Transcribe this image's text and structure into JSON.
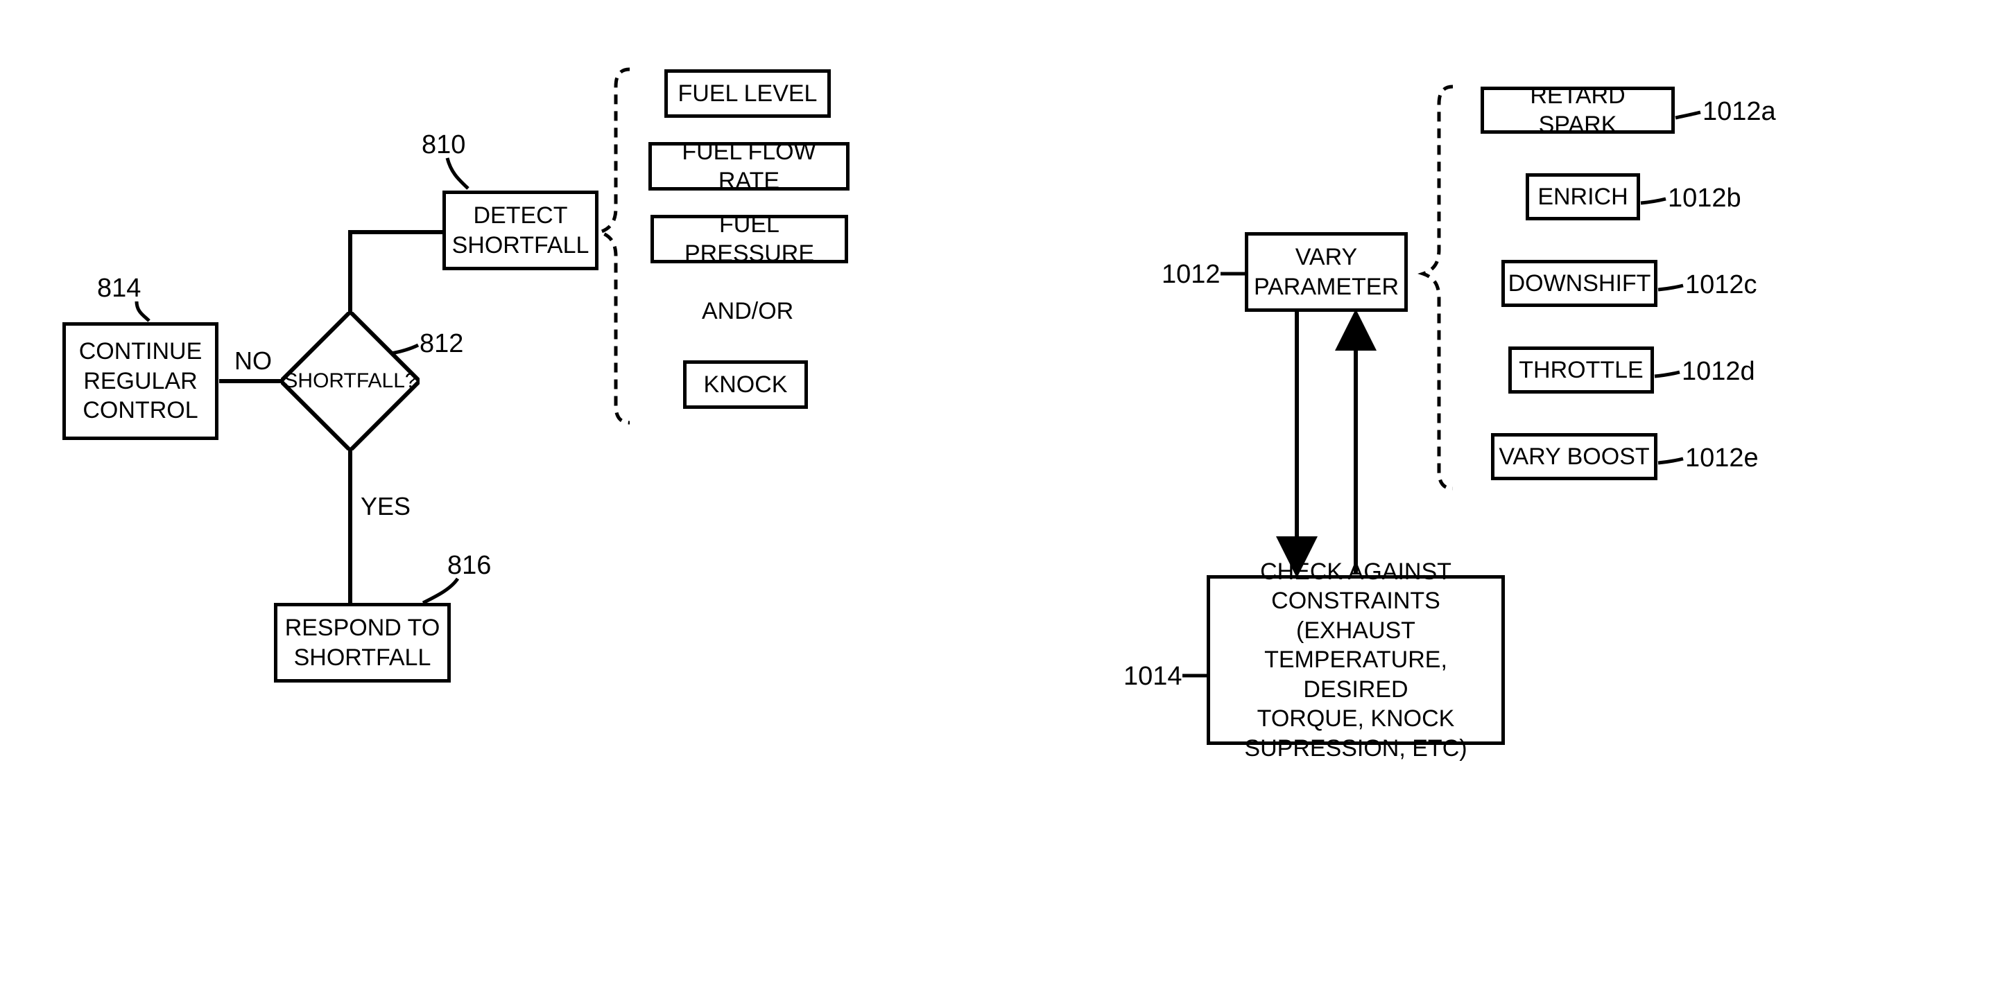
{
  "left": {
    "continue": {
      "text": "CONTINUE\nREGULAR\nCONTROL",
      "ref": "814"
    },
    "decision": {
      "text": "SHORTFALL?",
      "ref": "812",
      "no": "NO",
      "yes": "YES"
    },
    "detect": {
      "text": "DETECT\nSHORTFALL",
      "ref": "810"
    },
    "respond": {
      "text": "RESPOND TO\nSHORTFALL",
      "ref": "816"
    },
    "detect_opts": {
      "o1": "FUEL LEVEL",
      "o2": "FUEL FLOW RATE",
      "o3": "FUEL PRESSURE",
      "andor": "AND/OR",
      "o4": "KNOCK"
    }
  },
  "right": {
    "vary": {
      "text": "VARY\nPARAMETER",
      "ref": "1012"
    },
    "check": {
      "text": "CHECK AGAINST\nCONSTRAINTS (EXHAUST\nTEMPERATURE, DESIRED\nTORQUE, KNOCK\nSUPRESSION, ETC)",
      "ref": "1014"
    },
    "vary_opts": {
      "a": {
        "text": "RETARD SPARK",
        "ref": "1012a"
      },
      "b": {
        "text": "ENRICH",
        "ref": "1012b"
      },
      "c": {
        "text": "DOWNSHIFT",
        "ref": "1012c"
      },
      "d": {
        "text": "THROTTLE",
        "ref": "1012d"
      },
      "e": {
        "text": "VARY BOOST",
        "ref": "1012e"
      }
    }
  }
}
